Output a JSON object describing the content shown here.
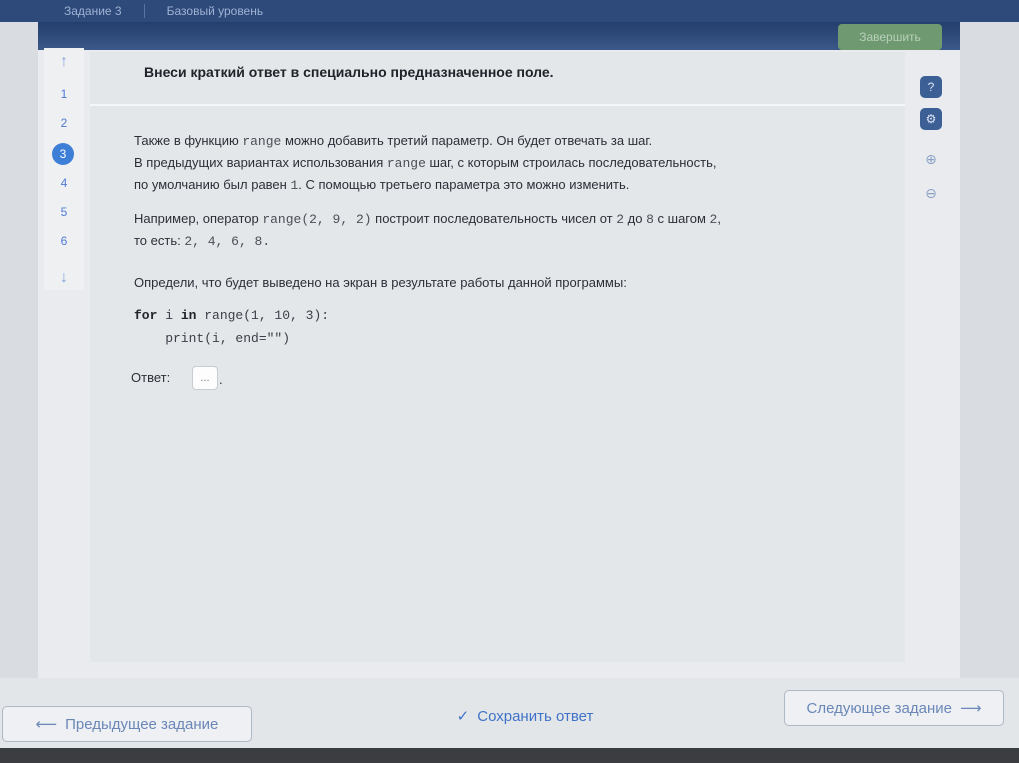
{
  "topbar": {
    "task_number": "Задание 3",
    "level": "Базовый уровень"
  },
  "header": {
    "finish_label": "Завершить"
  },
  "nav": {
    "up_arrow": "↑",
    "down_arrow": "↓",
    "items": [
      "1",
      "2",
      "3",
      "4",
      "5",
      "6"
    ],
    "current_index": 2
  },
  "task": {
    "instruction": "Внеси краткий ответ в специально предназначенное поле.",
    "p1_a": "Также в функцию ",
    "p1_code": "range",
    "p1_b": " можно добавить третий параметр. Он будет отвечать за шаг.",
    "p1_c": "В предыдущих вариантах использования ",
    "p1_code2": "range",
    "p1_d": " шаг, с которым строилась последовательность,",
    "p1_e": "по умолчанию был равен ",
    "p1_code3": "1",
    "p1_f": ". С помощью третьего параметра это можно изменить.",
    "p2_a": "Например, оператор ",
    "p2_code": "range(2, 9, 2)",
    "p2_b": " построит последовательность чисел от ",
    "p2_code2": "2",
    "p2_c": " до ",
    "p2_code3": "8",
    "p2_d": " с шагом ",
    "p2_code4": "2",
    "p2_e": ",",
    "p2_f": "то есть: ",
    "p2_code5": "2, 4, 6, 8.",
    "p3": "Определи, что будет выведено на экран в результате работы данной программы:",
    "code_line1_kw1": "for",
    "code_line1_mid": " i ",
    "code_line1_kw2": "in",
    "code_line1_rest": " range(1, 10, 3):",
    "code_line2": "    print(i, end=\"\")",
    "answer_label": "Ответ:",
    "answer_placeholder": "...",
    "answer_dot": "."
  },
  "tools": [
    {
      "name": "help-icon",
      "glyph": "?"
    },
    {
      "name": "settings-icon",
      "glyph": "⚙"
    },
    {
      "name": "zoom-in-icon",
      "glyph": "⊕"
    },
    {
      "name": "zoom-out-icon",
      "glyph": "⊖"
    }
  ],
  "footer": {
    "prev_label": "Предыдущее задание",
    "prev_arrow": "⟵",
    "save_label": "Сохранить ответ",
    "save_check": "✓",
    "next_label": "Следующее задание",
    "next_arrow": "⟶"
  },
  "colors": {
    "accent": "#3d7fd6",
    "header": "#2e4a7a",
    "finish": "#6f9a71",
    "tool": "#3c5f96"
  }
}
